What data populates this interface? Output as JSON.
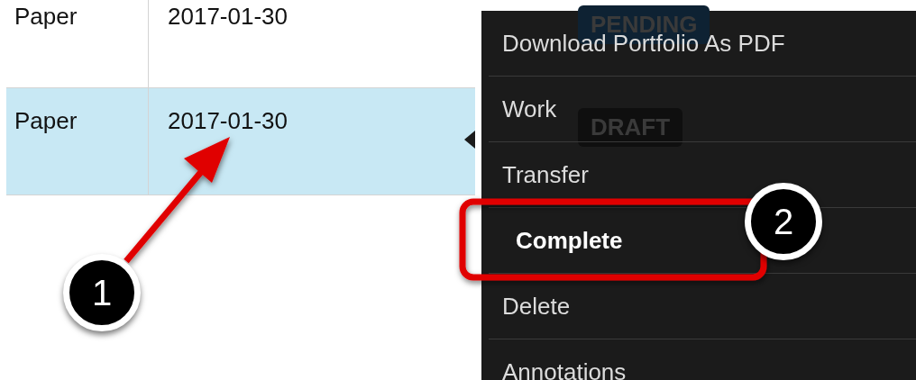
{
  "table": {
    "rows": [
      {
        "cells": [
          "Paper",
          "2017-01-30"
        ],
        "selected": false
      },
      {
        "cells": [
          "Paper",
          "2017-01-30"
        ],
        "selected": true
      }
    ]
  },
  "behind_menu": {
    "badges": [
      {
        "label": "PENDING",
        "color": "#0e2233"
      },
      {
        "label": "DRAFT",
        "color": "#0f0f0f"
      }
    ]
  },
  "menu": {
    "items": [
      {
        "label": "Download Portfolio As PDF",
        "selected": false
      },
      {
        "label": "Work",
        "selected": false
      },
      {
        "label": "Transfer",
        "selected": false
      },
      {
        "label": "Complete",
        "selected": true
      },
      {
        "label": "Delete",
        "selected": false
      },
      {
        "label": "Annotations",
        "selected": false
      }
    ]
  },
  "annotations": [
    {
      "kind": "marker",
      "label": "1"
    },
    {
      "kind": "marker",
      "label": "2"
    }
  ]
}
